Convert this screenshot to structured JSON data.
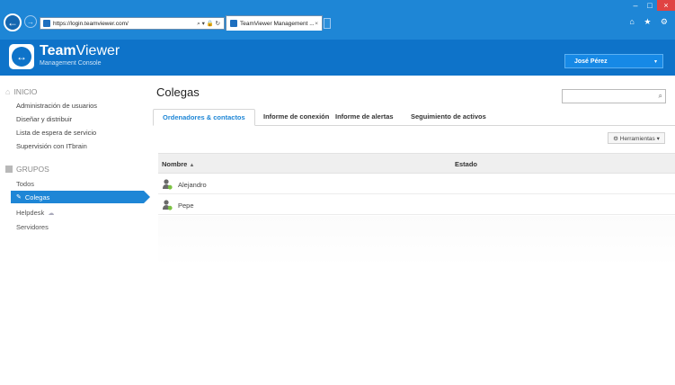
{
  "browser": {
    "address": "https://login.teamviewer.com/",
    "address_tools": "⌕ ▾ 🔒 ↻",
    "tab_title": "TeamViewer Management ...",
    "tab_close": "×",
    "back_glyph": "←",
    "forward_glyph": "→",
    "window_controls": [
      "–",
      "□",
      "×"
    ],
    "right_icons": "⌂ ★ ⚙"
  },
  "app": {
    "brand_light": "Viewer",
    "brand_bold": "Team",
    "subtitle": "Management Console",
    "logo_glyph": "↔",
    "user_name": "José Pérez",
    "user_caret": "▾"
  },
  "sidebar": {
    "home_section": "INICIO",
    "home_icon": "⌂",
    "home_items": [
      "Administración de usuarios",
      "Diseñar y distribuir",
      "Lista de espera de servicio",
      "Supervisión con ITbrain"
    ],
    "groups_section": "GRUPOS",
    "groups": [
      {
        "label": "Todos"
      },
      {
        "label": "Colegas",
        "active": true
      },
      {
        "label": "Helpdesk",
        "cloud": "☁"
      },
      {
        "label": "Servidores"
      }
    ],
    "pencil": "✎"
  },
  "main": {
    "title": "Colegas",
    "search_placeholder": "",
    "search_icon": "⌕",
    "tabs": [
      "Ordenadores & contactos",
      "Informe de conexión",
      "Informe de alertas",
      "Seguimiento de activos"
    ],
    "tools_label": "⚙ Herramientas ▾",
    "columns": {
      "name": "Nombre",
      "sort": "▲",
      "status": "Estado"
    },
    "rows": [
      {
        "name": "Alejandro",
        "status": ""
      },
      {
        "name": "Pepe",
        "status": ""
      }
    ]
  },
  "colors": {
    "chrome": "#1e86d6",
    "header": "#0e73c9",
    "accent": "#1e86d6",
    "online": "#7cc243"
  }
}
